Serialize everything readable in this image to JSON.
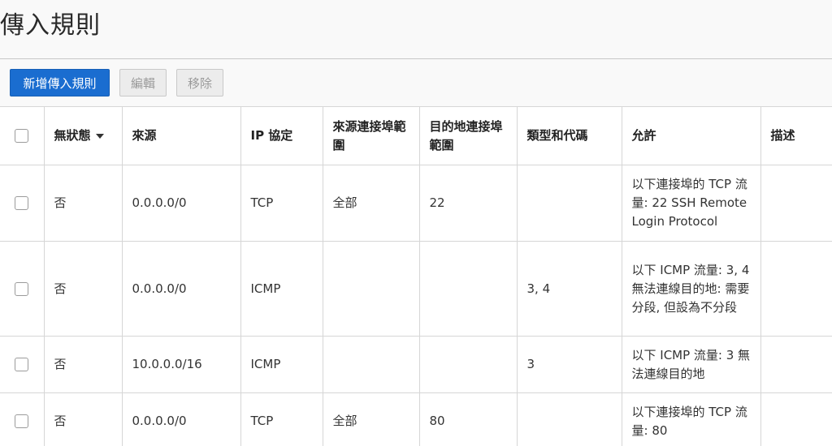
{
  "page": {
    "title": "傳入規則"
  },
  "toolbar": {
    "add_label": "新增傳入規則",
    "edit_label": "編輯",
    "remove_label": "移除"
  },
  "table": {
    "headers": {
      "stateless": "無狀態",
      "source": "來源",
      "ip_protocol": "IP 協定",
      "source_port_range": "來源連接埠範圍",
      "dest_port_range": "目的地連接埠範圍",
      "type_code": "類型和代碼",
      "allows": "允許",
      "description": "描述"
    },
    "rows": [
      {
        "stateless": "否",
        "source": "0.0.0.0/0",
        "ip_protocol": "TCP",
        "source_port_range": "全部",
        "dest_port_range": "22",
        "type_code": "",
        "allows": "以下連接埠的 TCP 流量: 22 SSH Remote Login Protocol",
        "description": ""
      },
      {
        "stateless": "否",
        "source": "0.0.0.0/0",
        "ip_protocol": "ICMP",
        "source_port_range": "",
        "dest_port_range": "",
        "type_code": "3, 4",
        "allows": "以下 ICMP 流量: 3, 4 無法連線目的地: 需要分段, 但設為不分段",
        "description": ""
      },
      {
        "stateless": "否",
        "source": "10.0.0.0/16",
        "ip_protocol": "ICMP",
        "source_port_range": "",
        "dest_port_range": "",
        "type_code": "3",
        "allows": "以下 ICMP 流量: 3 無法連線目的地",
        "description": ""
      },
      {
        "stateless": "否",
        "source": "0.0.0.0/0",
        "ip_protocol": "TCP",
        "source_port_range": "全部",
        "dest_port_range": "80",
        "type_code": "",
        "allows": "以下連接埠的 TCP 流量: 80",
        "description": ""
      }
    ]
  },
  "colors": {
    "primary": "#1a6dd0",
    "background": "#f9f9f9",
    "border": "#d6d6d6"
  }
}
